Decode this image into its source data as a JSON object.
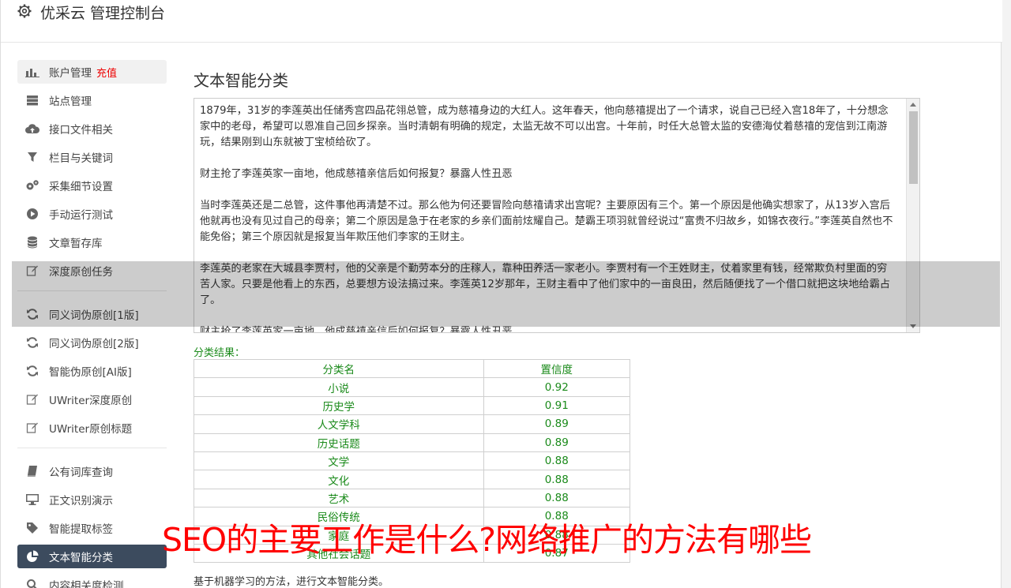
{
  "app": {
    "title": "优采云 管理控制台"
  },
  "sidebar": {
    "group1": [
      {
        "label": "账户管理",
        "badge": "充值",
        "icon": "bar-chart-icon"
      },
      {
        "label": "站点管理",
        "icon": "server-icon"
      },
      {
        "label": "接口文件相关",
        "icon": "cloud-upload-icon"
      },
      {
        "label": "栏目与关键词",
        "icon": "filter-icon"
      },
      {
        "label": "采集细节设置",
        "icon": "gears-icon"
      },
      {
        "label": "手动运行测试",
        "icon": "play-circle-icon"
      },
      {
        "label": "文章暂存库",
        "icon": "database-icon"
      },
      {
        "label": "深度原创任务",
        "icon": "edit-icon"
      }
    ],
    "group2": [
      {
        "label": "同义词伪原创[1版]",
        "icon": "refresh-icon"
      },
      {
        "label": "同义词伪原创[2版]",
        "icon": "refresh-icon"
      },
      {
        "label": "智能伪原创[AI版]",
        "icon": "refresh-icon"
      },
      {
        "label": "UWriter深度原创",
        "icon": "edit-icon"
      },
      {
        "label": "UWriter原创标题",
        "icon": "edit-icon"
      }
    ],
    "group3": [
      {
        "label": "公有词库查询",
        "icon": "book-icon"
      },
      {
        "label": "正文识别演示",
        "icon": "monitor-icon"
      },
      {
        "label": "智能提取标签",
        "icon": "tag-icon"
      },
      {
        "label": "文本智能分类",
        "icon": "pie-chart-icon"
      },
      {
        "label": "内容相关度检测",
        "icon": "search-icon"
      }
    ]
  },
  "main": {
    "heading": "文本智能分类",
    "text": "1879年，31岁的李莲英出任储秀宫四品花翎总管，成为慈禧身边的大红人。这年春天，他向慈禧提出了一个请求，说自己已经入宫18年了，十分想念家中的老母，希望可以恩准自己回乡探亲。当时清朝有明确的规定，太监无故不可以出宫。十年前，时任大总管太监的安德海仗着慈禧的宠信到江南游玩，结果刚到山东就被丁宝桢给砍了。\n\n财主抢了李莲英家一亩地，他成慈禧亲信后如何报复？暴露人性丑恶\n\n当时李莲英还是二总管，这件事他再清楚不过。那么他为何还要冒险向慈禧请求出宫呢？主要原因有三个。第一个原因是他确实想家了，从13岁入宫后他就再也没有见过自己的母亲；第二个原因是急于在老家的乡亲们面前炫耀自己。楚霸王项羽就曾经说过“富贵不归故乡，如锦衣夜行。”李莲英自然也不能免俗；第三个原因就是报复当年欺压他们李家的王财主。\n\n李莲英的老家在大城县李贾村，他的父亲是个勤劳本分的庄稼人，靠种田养活一家老小。李贾村有一个王姓财主，仗着家里有钱，经常欺负村里面的穷苦人家。只要是他看上的东西，总要想方设法搞过来。李莲英12岁那年，王财主看中了他们家中的一亩良田，然后随便找了一个借口就把这块地给霸占了。\n\n财主抢了李莲英家一亩地，他成慈禧亲信后如何报复？暴露人性丑恶",
    "result_label": "分类结果：",
    "table": {
      "headers": [
        "分类名",
        "置信度"
      ],
      "rows": [
        [
          "小说",
          "0.92"
        ],
        [
          "历史学",
          "0.91"
        ],
        [
          "人文学科",
          "0.89"
        ],
        [
          "历史话题",
          "0.89"
        ],
        [
          "文学",
          "0.88"
        ],
        [
          "文化",
          "0.88"
        ],
        [
          "艺术",
          "0.88"
        ],
        [
          "民俗传统",
          "0.88"
        ],
        [
          "家庭",
          "0.88"
        ],
        [
          "其他社会话题",
          "0.87"
        ]
      ]
    },
    "note": "基于机器学习的方法，进行文本智能分类。"
  },
  "overlay_caption": "SEO的主要工作是什么?网络推广的方法有哪些",
  "colors": {
    "active_bg": "#3c4b5e",
    "result_green": "#1a8a1a",
    "badge_red": "#e00000",
    "caption_red": "#ff0000"
  }
}
